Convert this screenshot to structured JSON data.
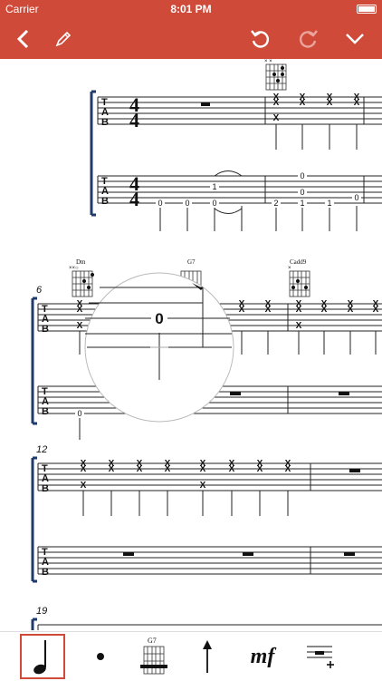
{
  "status": {
    "carrier": "Carrier",
    "time": "8:01 PM"
  },
  "toolbar": {
    "back": "back",
    "edit": "pencil",
    "undo": "undo",
    "redo": "redo",
    "menu": "chevron-down"
  },
  "score": {
    "tab_label": [
      "T",
      "A",
      "B"
    ],
    "time_signature": {
      "top": "4",
      "bottom": "4"
    },
    "chords": [
      "Dm",
      "G7",
      "Cadd9"
    ],
    "measure_numbers": [
      "6",
      "12",
      "19"
    ],
    "magnifier_fret": "0",
    "tab_numbers": {
      "system1_lower": [
        "0",
        "0",
        "0",
        "1",
        "2",
        "1",
        "1",
        "0",
        "0",
        "0"
      ],
      "system2_lower": [
        "0"
      ]
    }
  },
  "bottom_tools": {
    "note": "quarter-note",
    "dot": "dot",
    "chord_label": "G7",
    "arrow": "strum-up-arrow",
    "dynamic": "mf",
    "rest": "insert-rest"
  },
  "colors": {
    "accent": "#cf4a39",
    "staff": "#222222",
    "brace": "#1f3a6b"
  }
}
